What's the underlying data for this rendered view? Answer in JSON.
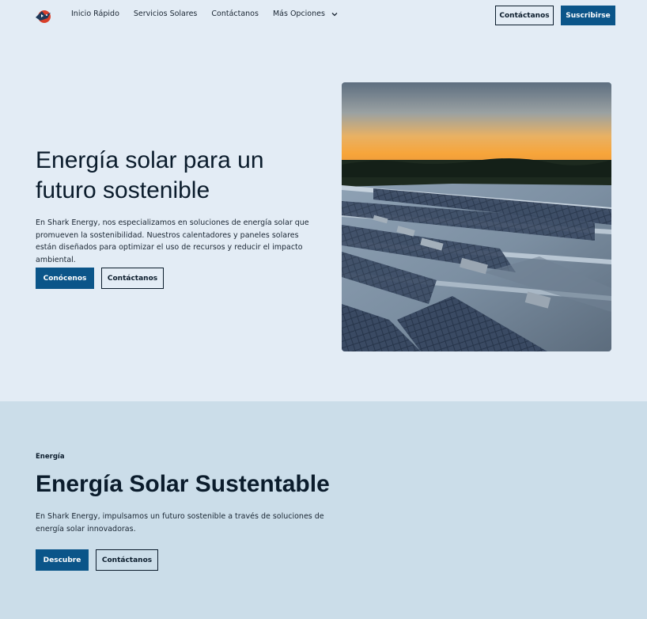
{
  "nav": {
    "links": [
      "Inicio Rápido",
      "Servicios Solares",
      "Contáctanos",
      "Más Opciones"
    ],
    "contact_label": "Contáctanos",
    "subscribe_label": "Suscribirse"
  },
  "hero": {
    "title": "Energía solar para un futuro sostenible",
    "text": "En Shark Energy, nos especializamos en soluciones de energía solar que promueven la sostenibilidad. Nuestros calentadores y paneles solares están diseñados para optimizar el uso de recursos y reducir el impacto ambiental.",
    "primary_label": "Conócenos",
    "secondary_label": "Contáctanos"
  },
  "section": {
    "tag": "Energía",
    "title": "Energía Solar Sustentable",
    "text": "En Shark Energy, impulsamos un futuro sostenible a través de soluciones de energía solar innovadoras.",
    "primary_label": "Descubre",
    "secondary_label": "Contáctanos"
  },
  "colors": {
    "accent": "#0b5589",
    "hero_bg": "#e3ecf5",
    "section_bg": "#cbdde9",
    "text": "#0b1c2c"
  },
  "icons": {
    "logo": "shark-logo-icon",
    "dropdown": "chevron-down-icon"
  }
}
